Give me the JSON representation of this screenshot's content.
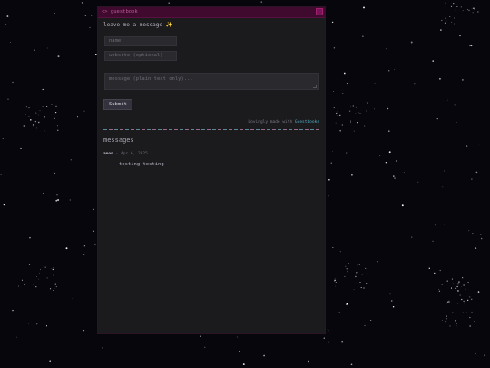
{
  "window": {
    "title": "<> guestbook"
  },
  "form": {
    "prompt": "leave me a message ✨",
    "name_placeholder": "name",
    "website_placeholder": "website (optional)",
    "message_placeholder": "message (plain text only)...",
    "submit_label": "Submit"
  },
  "credit": {
    "prefix": "Lovingly made with ",
    "link": "Guestbooks"
  },
  "messages": {
    "heading": "messages",
    "entries": [
      {
        "author": "anon",
        "separator": " - ",
        "date": "Apr 6, 2025",
        "body": "testing testing"
      }
    ]
  },
  "colors": {
    "background": "#07060c",
    "panel": "#1b1a1d",
    "titlebar": "#3f0a2e",
    "link": "#4fb0c6"
  }
}
